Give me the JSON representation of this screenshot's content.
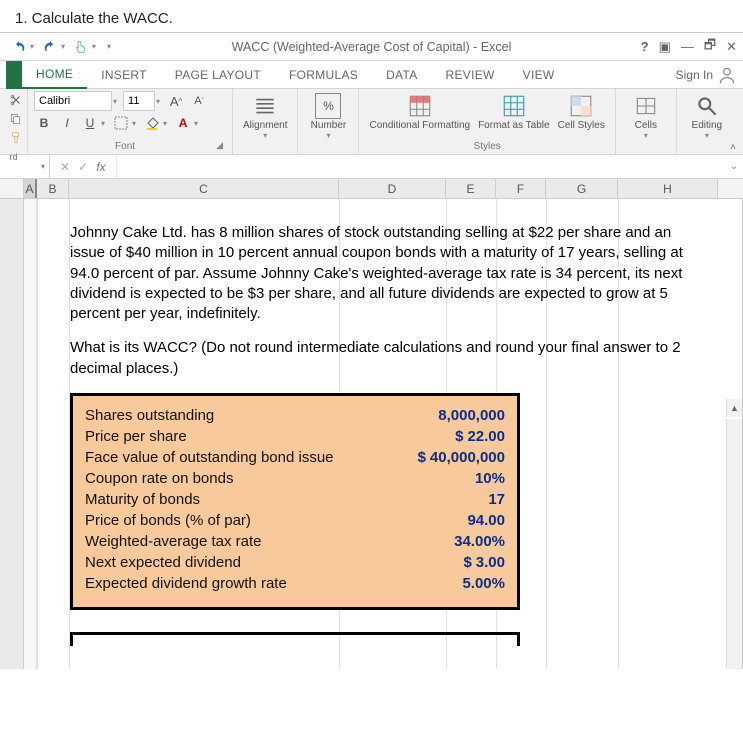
{
  "page_header": "1. Calculate the WACC.",
  "window_title": "WACC (Weighted-Average Cost of Capital) - Excel",
  "sign_in": "Sign In",
  "tabs": {
    "home": "HOME",
    "insert": "INSERT",
    "page_layout": "PAGE LAYOUT",
    "formulas": "FORMULAS",
    "data": "DATA",
    "review": "REVIEW",
    "view": "VIEW"
  },
  "ribbon": {
    "font_name": "Calibri",
    "font_size": "11",
    "group_font": "Font",
    "group_alignment": "Alignment",
    "group_number": "Number",
    "group_styles": "Styles",
    "btn_cond_format": "Conditional Formatting",
    "btn_format_table": "Format as Table",
    "btn_cell_styles": "Cell Styles",
    "btn_cells": "Cells",
    "btn_editing": "Editing",
    "clipboard_label": "rd"
  },
  "columns": {
    "A": "A",
    "B": "B",
    "C": "C",
    "D": "D",
    "E": "E",
    "F": "F",
    "G": "G",
    "H": "H"
  },
  "problem_text": "Johnny Cake Ltd. has 8 million shares of stock outstanding selling at $22 per share and an issue of $40 million in 10 percent annual coupon bonds with a maturity of 17 years, selling at 94.0 percent of par. Assume Johnny Cake's weighted-average tax rate is 34 percent, its next dividend is expected to be $3 per share, and all future dividends are expected to grow at 5 percent per year, indefinitely.",
  "problem_q": "What is its WACC? (Do not round intermediate calculations and round your final answer to 2 decimal places.)",
  "data_box": {
    "rows": [
      {
        "label": "Shares outstanding",
        "cur": "",
        "val": "8,000,000"
      },
      {
        "label": "Price per share",
        "cur": "$",
        "val": "22.00"
      },
      {
        "label": "Face value of outstanding bond issue",
        "cur": "$",
        "val": "40,000,000"
      },
      {
        "label": "Coupon rate on bonds",
        "cur": "",
        "val": "10%"
      },
      {
        "label": "Maturity of bonds",
        "cur": "",
        "val": "17"
      },
      {
        "label": "Price of bonds (% of par)",
        "cur": "",
        "val": "94.00"
      },
      {
        "label": "Weighted-average tax rate",
        "cur": "",
        "val": "34.00%"
      },
      {
        "label": "Next expected dividend",
        "cur": "$",
        "val": "3.00"
      },
      {
        "label": "Expected dividend growth rate",
        "cur": "",
        "val": "5.00%"
      }
    ]
  }
}
